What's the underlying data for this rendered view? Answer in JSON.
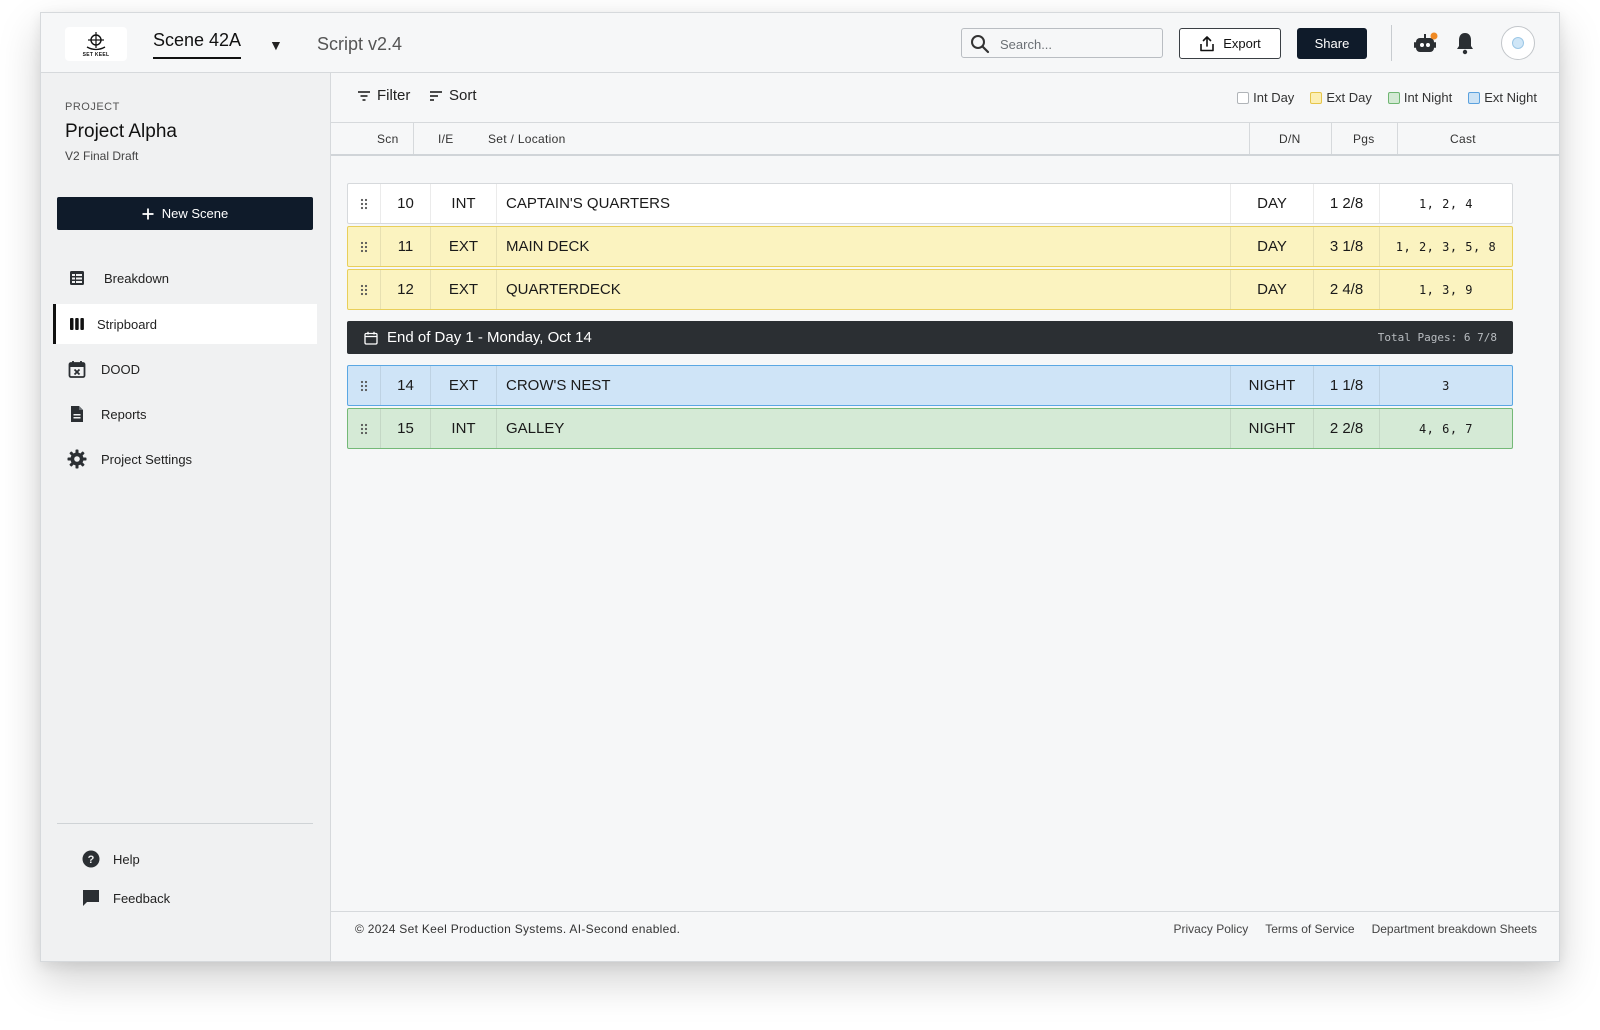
{
  "header": {
    "logo_text": "SET KEEL",
    "scene_name": "Scene 42A",
    "script_version": "Script v2.4",
    "search_placeholder": "Search...",
    "export_label": "Export",
    "share_label": "Share"
  },
  "sidebar": {
    "kicker": "PROJECT",
    "project_name": "Project Alpha",
    "draft": "V2 Final Draft",
    "new_scene_label": "New Scene",
    "items": [
      {
        "label": "Breakdown",
        "icon": "table-icon"
      },
      {
        "label": "Stripboard",
        "icon": "stripboard-icon",
        "active": true
      },
      {
        "label": "DOOD",
        "icon": "calendar-x-icon"
      },
      {
        "label": "Reports",
        "icon": "document-icon"
      },
      {
        "label": "Project Settings",
        "icon": "gear-icon"
      }
    ],
    "footer_items": [
      {
        "label": "Help",
        "icon": "help-icon"
      },
      {
        "label": "Feedback",
        "icon": "chat-icon"
      }
    ]
  },
  "toolbar": {
    "filter_label": "Filter",
    "sort_label": "Sort",
    "legend": [
      {
        "label": "Int Day",
        "color": "#ffffff",
        "border": "#b0b4b8"
      },
      {
        "label": "Ext Day",
        "color": "#fcefb4",
        "border": "#e6c54a"
      },
      {
        "label": "Int Night",
        "color": "#d3e9d4",
        "border": "#6fb672"
      },
      {
        "label": "Ext Night",
        "color": "#cde3f5",
        "border": "#5aa1de"
      }
    ]
  },
  "columns": [
    "Scn",
    "I/E",
    "Set / Location",
    "D/N",
    "Pgs",
    "Cast"
  ],
  "strips": [
    {
      "scn": "10",
      "ie": "INT",
      "set": "CAPTAIN'S QUARTERS",
      "dn": "DAY",
      "pgs": "1 2/8",
      "cast": "1, 2, 4",
      "bg": "#ffffff",
      "border": "#d6d9dc"
    },
    {
      "scn": "11",
      "ie": "EXT",
      "set": "MAIN DECK",
      "dn": "DAY",
      "pgs": "3 1/8",
      "cast": "1, 2, 3, 5, 8",
      "bg": "#fbf3c0",
      "border": "#e9cf5a"
    },
    {
      "scn": "12",
      "ie": "EXT",
      "set": "QUARTERDECK",
      "dn": "DAY",
      "pgs": "2 4/8",
      "cast": "1, 3, 9",
      "bg": "#fbf3c0",
      "border": "#e9cf5a"
    }
  ],
  "day_break": {
    "label": "End of Day 1 - Monday, Oct 14",
    "total": "Total Pages: 6 7/8"
  },
  "strips_after": [
    {
      "scn": "14",
      "ie": "EXT",
      "set": "CROW'S NEST",
      "dn": "NIGHT",
      "pgs": "1 1/8",
      "cast": "3",
      "bg": "#cfe4f7",
      "border": "#5aa7e3"
    },
    {
      "scn": "15",
      "ie": "INT",
      "set": "GALLEY",
      "dn": "NIGHT",
      "pgs": "2 2/8",
      "cast": "4, 6, 7",
      "bg": "#d5ead6",
      "border": "#74b977"
    }
  ],
  "footer": {
    "copyright": "© 2024 Set Keel Production Systems. AI-Second enabled.",
    "links": [
      "Privacy Policy",
      "Terms of Service",
      "Department breakdown Sheets"
    ]
  }
}
